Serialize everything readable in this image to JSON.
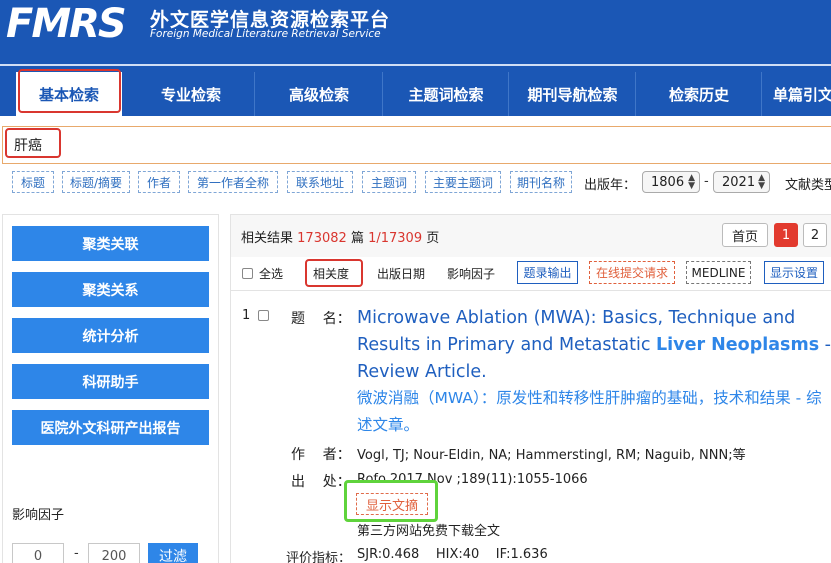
{
  "header": {
    "logo_text": "FMRS",
    "title_cn": "外文医学信息资源检索平台",
    "title_en": "Foreign Medical Literature Retrieval Service"
  },
  "nav": {
    "tabs": [
      {
        "label": "基本检索",
        "active": true
      },
      {
        "label": "专业检索",
        "active": false
      },
      {
        "label": "高级检索",
        "active": false
      },
      {
        "label": "主题词检索",
        "active": false
      },
      {
        "label": "期刊导航检索",
        "active": false
      },
      {
        "label": "检索历史",
        "active": false
      },
      {
        "label": "单篇引文",
        "active": false
      }
    ]
  },
  "search": {
    "query": "肝癌",
    "field_tags": [
      "标题",
      "标题/摘要",
      "作者",
      "第一作者全称",
      "联系地址",
      "主题词",
      "主要主题词",
      "期刊名称"
    ],
    "year_label": "出版年：",
    "year_from": "1806",
    "year_to": "2021",
    "year_sep": "-",
    "doctype_label": "文献类型"
  },
  "sidebar": {
    "buttons": [
      "聚类关联",
      "聚类关系",
      "统计分析",
      "科研助手",
      "医院外文科研产出报告"
    ],
    "impact_factor_label": "影响因子",
    "if_min": "0",
    "if_max": "200",
    "if_sep": "-",
    "filter_button": "过滤"
  },
  "results": {
    "label_prefix": "相关结果",
    "total": "173082",
    "unit_articles": "篇",
    "page_info": "1/17309",
    "unit_pages": "页",
    "first_page": "首页",
    "pages": [
      "1",
      "2"
    ],
    "current_page": "1",
    "select_all": "全选",
    "sort_options": [
      "相关度",
      "出版日期",
      "影响因子"
    ],
    "actions": [
      {
        "label": "题录输出",
        "color": "#1f5fbf"
      },
      {
        "label": "在线提交请求",
        "color": "#e0603c"
      },
      {
        "label": "MEDLINE",
        "color": "#222222"
      },
      {
        "label": "显示设置",
        "color": "#1f5fbf"
      }
    ]
  },
  "record": {
    "number": "1",
    "title_label": "题    名：",
    "title_en_part1": "Microwave Ablation (MWA): Basics, Technique and Results in Primary and Metastatic ",
    "title_en_keyword": "Liver Neoplasms",
    "title_en_part2": " - Review Article.",
    "title_cn": "微波消融（MWA）：原发性和转移性肝肿瘤的基础，技术和结果 - 综述文章。",
    "author_label": "作    者：",
    "authors": "Vogl, TJ; Nour-Eldin, NA; Hammerstingl, RM; Naguib, NNN;等",
    "source_label": "出    处：",
    "source": "Rofo.2017 Nov ;189(11):1055-1066",
    "show_abstract": "显示文摘",
    "free_download": "第三方网站免费下载全文",
    "eval_label": "评价指标：",
    "metrics": "SJR:0.468    HIX:40    IF:1.636"
  },
  "colors": {
    "brand_blue": "#1b57b5",
    "button_blue": "#2e86e8",
    "highlight_red": "#d9362f",
    "highlight_green": "#5fd33c"
  }
}
